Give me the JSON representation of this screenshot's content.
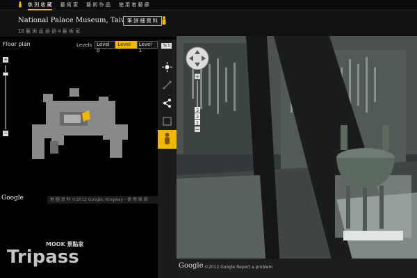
{
  "topnav": {
    "items": [
      "焦 列 收 藏",
      "藝 術 家",
      "藝 術 作 品",
      "使 用 者 藝 廊"
    ],
    "active_index": 0
  },
  "header": {
    "title": "National Palace Museum, Taiwan",
    "details_button": "筆 詳 細 資 料",
    "subtitle": "18 藝 術 品 過 過 4 藝 術 家"
  },
  "floor_plan": {
    "title": "Floor plan",
    "levels_label": "Levels",
    "levels": [
      "Level 0",
      "Level 2",
      "Level 1"
    ],
    "active_level": "Level 2",
    "google_logo": "Google",
    "footer": "地 圖 資 料 ©2012 Google, Kingway - 使 用 條 款"
  },
  "toolbar": {
    "tag_label": "Ta 1",
    "icons": [
      "sun-icon",
      "measure-icon",
      "share-icon",
      "expand-icon",
      "pegman-icon"
    ]
  },
  "street_view": {
    "zoom_labels": [
      "3",
      "2",
      "1"
    ],
    "google_logo": "Google",
    "footer": "©2012 Google    Report a problem"
  },
  "watermark": {
    "brand": "Tripass",
    "sub": "MOOK 景點家"
  },
  "colors": {
    "accent": "#f2b705",
    "background": "#000000",
    "panel": "#1b1b1b"
  }
}
